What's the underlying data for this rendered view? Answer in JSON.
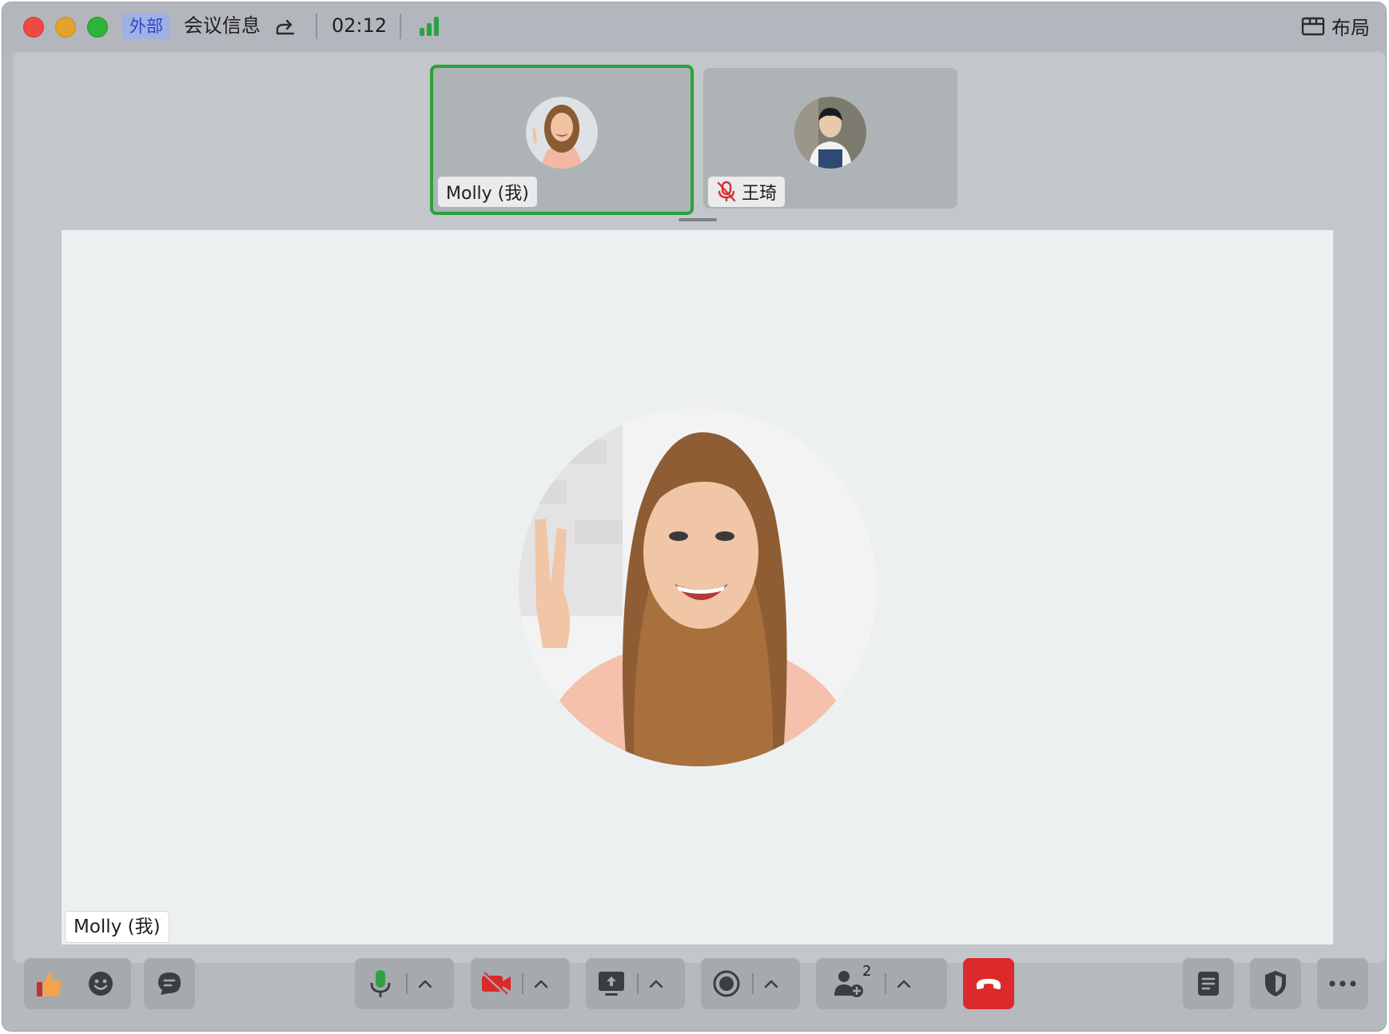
{
  "titlebar": {
    "badge": "外部",
    "meeting_info": "会议信息",
    "timer": "02:12",
    "layout_label": "布局"
  },
  "participants": [
    {
      "name": "Molly (我)",
      "active": true,
      "muted": false
    },
    {
      "name": "王琦",
      "active": false,
      "muted": true
    }
  ],
  "main_view": {
    "speaker_name": "Molly (我)"
  },
  "toolbar": {
    "participant_count": "2"
  },
  "colors": {
    "active_border": "#2aa33a",
    "end_call": "#dc2a2c",
    "badge_bg": "#9fb0e3",
    "badge_text": "#2747c9",
    "mic_green": "#2fa043",
    "camera_off_red": "#dc2a2c"
  },
  "icons": {
    "share": "share-icon",
    "signal": "signal-strength-icon",
    "layout": "layout-icon",
    "thumbs_up": "thumbs-up-icon",
    "emoji": "emoji-icon",
    "chat": "chat-icon",
    "mic": "microphone-icon",
    "camera_off": "camera-off-icon",
    "screen_share": "screen-share-icon",
    "record": "record-icon",
    "add_participant": "add-participant-icon",
    "end_call": "end-call-icon",
    "notes": "notes-icon",
    "security": "shield-icon",
    "more": "more-icon"
  }
}
